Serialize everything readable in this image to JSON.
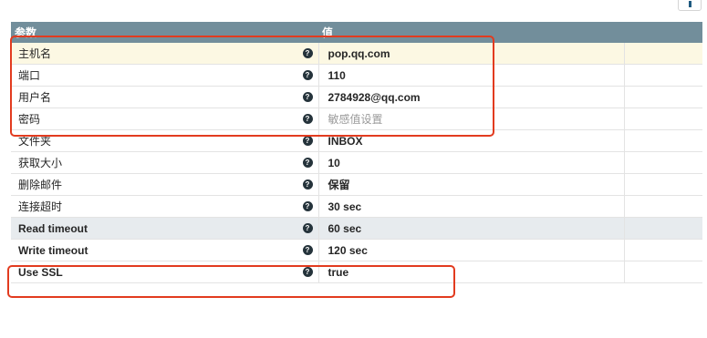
{
  "header": {
    "col_name": "参数",
    "col_value": "值"
  },
  "rows": [
    {
      "name": "主机名",
      "value": "pop.qq.com"
    },
    {
      "name": "端口",
      "value": "110"
    },
    {
      "name": "用户名",
      "value": "2784928@qq.com"
    },
    {
      "name": "密码",
      "value": "敏感值设置"
    },
    {
      "name": "文件夹",
      "value": "INBOX"
    },
    {
      "name": "获取大小",
      "value": "10"
    },
    {
      "name": "删除邮件",
      "value": "保留"
    },
    {
      "name": "连接超时",
      "value": "30 sec"
    },
    {
      "name": "Read timeout",
      "value": "60 sec"
    },
    {
      "name": "Write timeout",
      "value": "120 sec"
    },
    {
      "name": "Use SSL",
      "value": "true"
    }
  ],
  "icons": {
    "help": "question-circle-icon",
    "corner": "info-button-icon"
  },
  "colors": {
    "header_bg": "#728e9b",
    "highlight_row": "#fcf8e3",
    "selected_row": "#e7ebee",
    "annotation": "#e23b1f"
  }
}
